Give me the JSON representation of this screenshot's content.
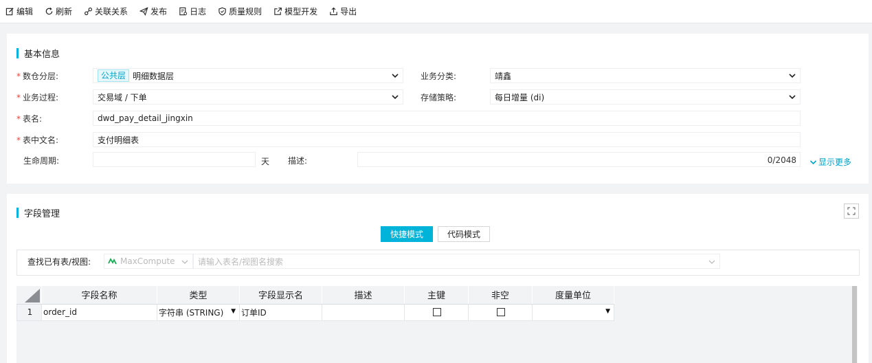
{
  "toolbar": {
    "items": [
      {
        "label": "编辑",
        "icon": "edit-icon"
      },
      {
        "label": "刷新",
        "icon": "refresh-icon"
      },
      {
        "label": "关联关系",
        "icon": "link-icon"
      },
      {
        "label": "发布",
        "icon": "send-icon"
      },
      {
        "label": "日志",
        "icon": "log-icon"
      },
      {
        "label": "质量规则",
        "icon": "shield-icon"
      },
      {
        "label": "模型开发",
        "icon": "external-link-icon"
      },
      {
        "label": "导出",
        "icon": "export-icon"
      }
    ]
  },
  "basic": {
    "title": "基本信息",
    "layer_label": "数仓分层:",
    "layer_tag": "公共层",
    "layer_value": "明细数据层",
    "category_label": "业务分类:",
    "category_value": "靖鑫",
    "process_label": "业务过程:",
    "process_value": "交易域 / 下单",
    "storage_label": "存储策略:",
    "storage_value": "每日增量 (di)",
    "table_name_label": "表名:",
    "table_name_value": "dwd_pay_detail_jingxin",
    "table_cn_label": "表中文名:",
    "table_cn_value": "支付明细表",
    "lifecycle_label": "生命周期:",
    "lifecycle_value": "",
    "lifecycle_unit": "天",
    "desc_label": "描述:",
    "desc_counter": "0/2048",
    "show_more": "显示更多",
    "required_mark": "*"
  },
  "fields": {
    "title": "字段管理",
    "mode_quick": "快捷模式",
    "mode_code": "代码模式",
    "search_label": "查找已有表/视图:",
    "source_value": "MaxCompute",
    "search_placeholder": "请输入表名/视图名搜索",
    "columns": [
      "字段名称",
      "类型",
      "字段显示名",
      "描述",
      "主键",
      "非空",
      "度量单位"
    ],
    "rows": [
      {
        "index": "1",
        "name": "order_id",
        "type": "字符串 (STRING)",
        "display": "订单ID",
        "desc": "",
        "pk": false,
        "not_null": false,
        "unit": ""
      }
    ]
  },
  "colors": {
    "accent": "#00b3d9",
    "required": "#e5413a",
    "link": "#00a2c7"
  }
}
